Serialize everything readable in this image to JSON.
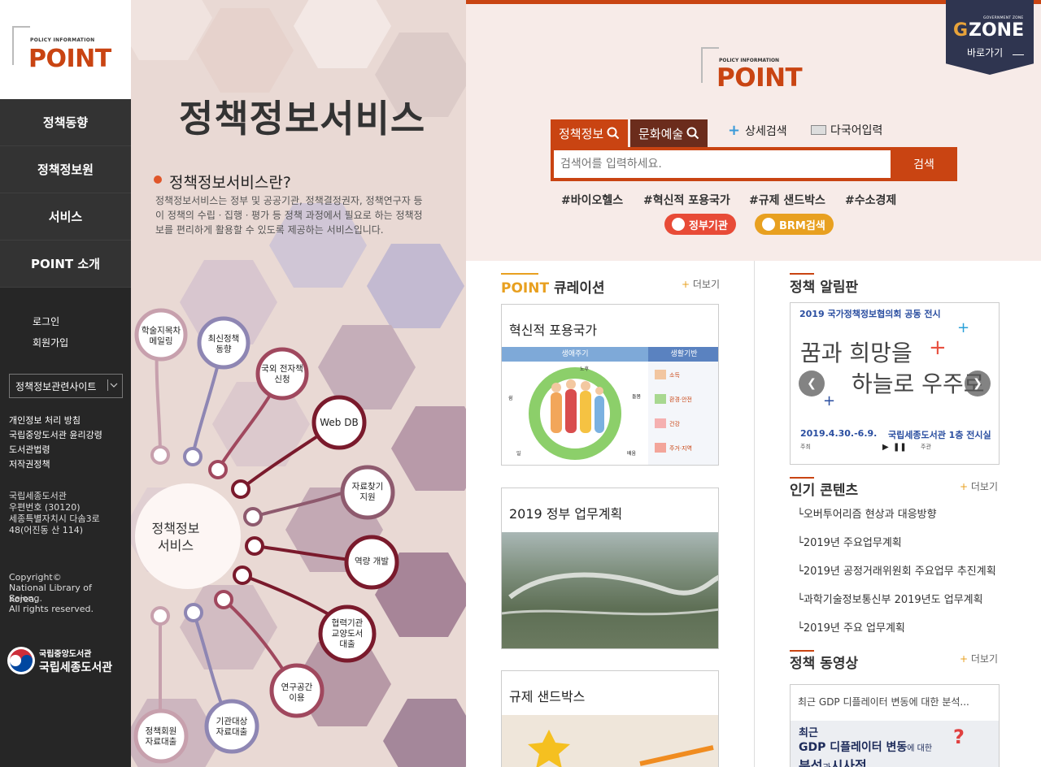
{
  "sidebar": {
    "logo_small": "POLICY INFORMATION",
    "logo_main": "POINT",
    "nav": [
      "정책동향",
      "정책정보원",
      "서비스",
      "POINT 소개"
    ],
    "auth": [
      "로그인",
      "회원가입"
    ],
    "site_select": "정책정보관련사이트",
    "footer_links": [
      "개인정보 처리 방침",
      "국립중앙도서관 윤리강령",
      "도서관법령",
      "저작권정책"
    ],
    "address": [
      "국립세종도서관",
      "우편번호 (30120)",
      "세종특별자치시 다솜3로",
      "48(어진동 산 114)"
    ],
    "copyright": [
      "Copyright©",
      "National Library of Korea,",
      "Sejong.",
      "All rights reserved."
    ],
    "org_small": "국립중앙도서관",
    "org_main": "국립세종도서관"
  },
  "middle": {
    "title": "정책정보서비스",
    "subtitle": "정책정보서비스란?",
    "description": "정책정보서비스는 정부 및 공공기관, 정책결정권자, 정책연구자 등이 정책의 수립ㆍ집행ㆍ평가 등 정책 과정에서 필요로 하는 정책정보를 편리하게 활용할 수 있도록 제공하는 서비스입니다.",
    "center_label": [
      "정책정보",
      "서비스"
    ],
    "bubbles": [
      [
        "학술지목차",
        "메일링"
      ],
      [
        "최신정책",
        "동향"
      ],
      [
        "국외 전자책",
        "신청"
      ],
      [
        "Web DB"
      ],
      [
        "자료찾기",
        "지원"
      ],
      [
        "역량 개발"
      ],
      [
        "협력기관",
        "교양도서",
        "대출"
      ],
      [
        "연구공간",
        "이용"
      ],
      [
        "기관대상",
        "자료대출"
      ],
      [
        "정책회원",
        "자료대출"
      ]
    ]
  },
  "header": {
    "gzone_small": "GOVERNMENT ZONE",
    "gzone_main": "ZONE",
    "gzone_g": "G",
    "gzone_link": "바로가기",
    "logo_small": "POLICY INFORMATION",
    "logo_main": "POINT"
  },
  "search": {
    "tab_active": "정책정보",
    "tab_other": "문화예술",
    "advanced": "상세검색",
    "multilang": "다국어입력",
    "placeholder": "검색어를 입력하세요.",
    "button": "검색",
    "tags": [
      "#바이오헬스",
      "#혁신적 포용국가",
      "#규제 샌드박스",
      "#수소경제"
    ],
    "pill_gov": "정부기관",
    "pill_brm": "BRM검색"
  },
  "curation": {
    "title_accent": "POINT",
    "title_rest": "큐레이션",
    "more": "더보기",
    "cards": [
      {
        "title": "혁신적 포용국가",
        "col1": "생애주기",
        "col2": "생활기반",
        "items": [
          "소득",
          "환경·안전",
          "건강",
          "주거·지역"
        ],
        "ring": [
          "노후",
          "돌봄",
          "배움",
          "일",
          "쉼"
        ]
      },
      {
        "title": "2019 정부 업무계획"
      },
      {
        "title": "규제 샌드박스"
      }
    ]
  },
  "notice": {
    "title": "정책 알림판",
    "banner_top": "2019 국가정책정보협의회 공동 전시",
    "banner_line1": "꿈과 희망을",
    "banner_line2": "하늘로 우주로",
    "banner_date": "2019.4.30.-6.9.",
    "banner_place": "국립세종도서관 1층 전시실",
    "banner_host": "주최",
    "banner_org": "주관"
  },
  "popular": {
    "title": "인기 콘텐츠",
    "more": "더보기",
    "items": [
      "오버투어리즘 현상과 대응방향",
      "2019년 주요업무계획",
      "2019년 공정거래위원회 주요업무 추진계획",
      "과학기술정보통신부 2019년도 업무계획",
      "2019년 주요 업무계획"
    ]
  },
  "video": {
    "title": "정책 동영상",
    "more": "더보기",
    "caption": "최근 GDP 디플레이터 변동에 대한 분석...",
    "thumb_line1": "최근",
    "thumb_line2a": "GDP 디플레이터 변동",
    "thumb_line2b": "에 대한",
    "thumb_line3a": "분석",
    "thumb_line3b": "과",
    "thumb_line3c": "시사점"
  },
  "colors": {
    "accent": "#c94412",
    "sidebar": "#262626",
    "maroon": "#7a1a2c",
    "gzone": "#2f3550",
    "search_bg": "#f7ebe8"
  }
}
